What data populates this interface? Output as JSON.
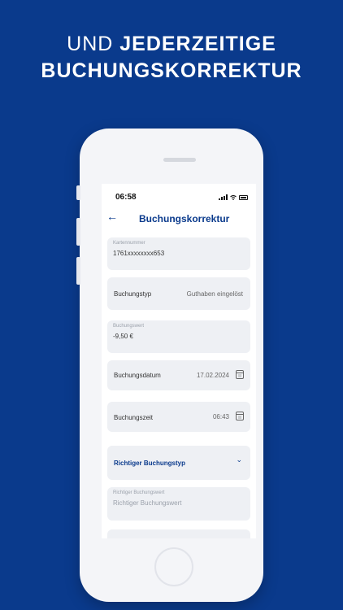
{
  "headline": {
    "light": "UND ",
    "bold1": "JEDERZEITIGE",
    "bold2": "BUCHUNGSKORREKTUR"
  },
  "status_bar": {
    "time": "06:58"
  },
  "screen": {
    "title": "Buchungskorrektur"
  },
  "fields": {
    "karte": {
      "label": "Kartennummer",
      "value": "1761xxxxxxxx653"
    },
    "buchungstyp": {
      "label": "Buchungstyp",
      "value": "Guthaben eingelöst"
    },
    "buchungswert": {
      "label": "Buchungswert",
      "value": "-9,50 €"
    },
    "buchungsdatum": {
      "label": "Buchungsdatum",
      "value": "17.02.2024"
    },
    "buchungszeit": {
      "label": "Buchungszeit",
      "value": "06:43"
    },
    "richtiger_typ": {
      "label": "Richtiger Buchungstyp"
    },
    "richtiger_wert": {
      "label": "Richtiger Buchungswert",
      "placeholder": "Richtiger Buchungswert"
    }
  },
  "colors": {
    "background": "#0a3a8c",
    "accent": "#0a3a8c",
    "field": "#eef0f4"
  },
  "icons": {
    "back": "arrow-left-icon",
    "calendar": "calendar-icon",
    "dropdown": "chevron-down-icon"
  }
}
